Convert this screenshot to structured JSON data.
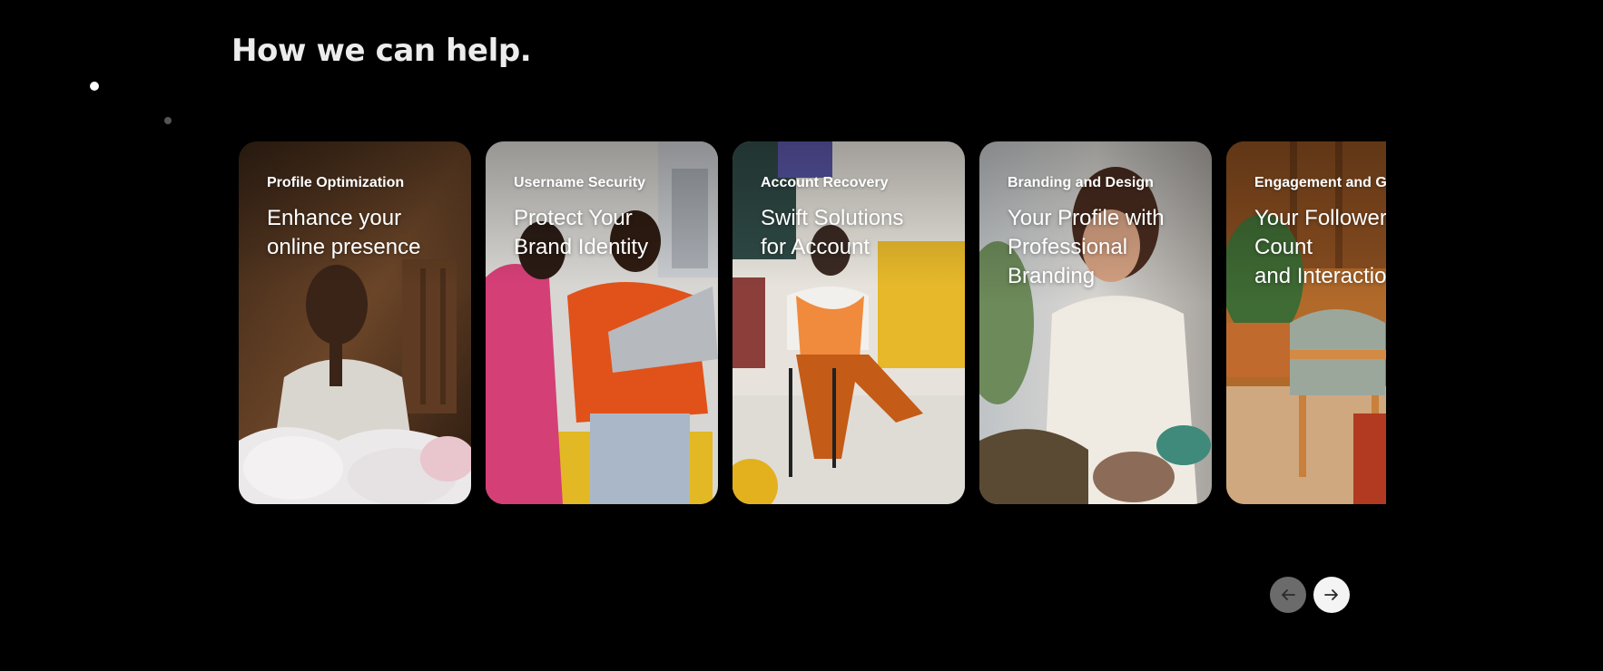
{
  "section": {
    "title": "How we can help."
  },
  "cards": [
    {
      "category": "Profile Optimization",
      "heading": "Enhance your\nonline presence",
      "image": "smiling man sorting white bags in a wood-paneled room"
    },
    {
      "category": "Username Security",
      "heading": "Protect Your\nBrand Identity",
      "image": "two people looking at a laptop together in an office"
    },
    {
      "category": "Account Recovery",
      "heading": "Swift Solutions\nfor Account",
      "image": "person in orange outfit sitting on a stool using a phone"
    },
    {
      "category": "Branding and Design",
      "heading": "Your Profile with\nProfessional\nBranding",
      "image": "laughing woman in a white shirt"
    },
    {
      "category": "Engagement and Gr",
      "heading": "Your Follower\nCount\nand Interactio",
      "image": "wooden chair with pillows beside potted plants"
    }
  ],
  "navigation": {
    "prev_icon": "arrow-left-icon",
    "next_icon": "arrow-right-icon"
  },
  "colors": {
    "background": "#000000",
    "title": "#ececec",
    "active_dot": "#ffffff",
    "inactive_dot": "#555555",
    "prev_button": "#6b6b6b",
    "next_button": "#f4f4f4"
  }
}
